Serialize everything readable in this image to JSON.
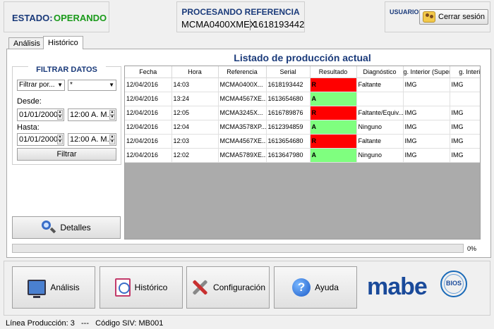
{
  "header": {
    "estado_label": "ESTADO:",
    "estado_value": "OPERANDO",
    "procesando_title": "PROCESANDO REFERENCIA",
    "procesando_model": "MCMA0400XMEX",
    "procesando_serial": "1618193442",
    "usuario_label": "USUARIO",
    "logout_label": "Cerrar sesión"
  },
  "tabs": [
    {
      "label": "Análisis",
      "active": false
    },
    {
      "label": "Histórico",
      "active": true
    }
  ],
  "filter": {
    "title": "FILTRAR DATOS",
    "filter_by": "Filtrar por...",
    "filter_value": "*",
    "desde_label": "Desde:",
    "desde_date": "01/01/2000",
    "desde_time": "12:00 A. M.",
    "hasta_label": "Hasta:",
    "hasta_date": "01/01/2000",
    "hasta_time": "12:00 A. M.",
    "button_label": "Filtrar"
  },
  "detalles_label": "Detalles",
  "table": {
    "title": "Listado de producción actual",
    "columns": [
      "Fecha",
      "Hora",
      "Referencia",
      "Serial",
      "Resultado",
      "Diagnóstico",
      "g. Interior (Superi",
      "g. Interior ("
    ],
    "rows": [
      {
        "fecha": "12/04/2016",
        "hora": "14:03",
        "referencia": "MCMA0400X...",
        "serial": "1618193442",
        "resultado": "R",
        "diagnostico": "Faltante",
        "int_sup": "IMG",
        "int_inf": "IMG"
      },
      {
        "fecha": "12/04/2016",
        "hora": "13:24",
        "referencia": "MCMA4567XE...",
        "serial": "1613654680",
        "resultado": "A",
        "diagnostico": "",
        "int_sup": "",
        "int_inf": ""
      },
      {
        "fecha": "12/04/2016",
        "hora": "12:05",
        "referencia": "MCMA3245X...",
        "serial": "1616789876",
        "resultado": "R",
        "diagnostico": "Faltante/Equiv...",
        "int_sup": "IMG",
        "int_inf": "IMG"
      },
      {
        "fecha": "12/04/2016",
        "hora": "12:04",
        "referencia": "MCMA3578XP...",
        "serial": "1612394859",
        "resultado": "A",
        "diagnostico": "Ninguno",
        "int_sup": "IMG",
        "int_inf": "IMG"
      },
      {
        "fecha": "12/04/2016",
        "hora": "12:03",
        "referencia": "MCMA4567XE...",
        "serial": "1613654680",
        "resultado": "R",
        "diagnostico": "Faltante",
        "int_sup": "IMG",
        "int_inf": "IMG"
      },
      {
        "fecha": "12/04/2016",
        "hora": "12:02",
        "referencia": "MCMA5789XE...",
        "serial": "1613647980",
        "resultado": "A",
        "diagnostico": "Ninguno",
        "int_sup": "IMG",
        "int_inf": "IMG"
      }
    ]
  },
  "progress": {
    "value": 0,
    "label": "0%"
  },
  "nav": {
    "analisis": "Análisis",
    "historico": "Histórico",
    "configuracion": "Configuración",
    "ayuda": "Ayuda"
  },
  "logos": {
    "mabe": "mabe",
    "bios": "BIOS"
  },
  "status_line": "Línea Producción: 3   ---   Código SIV: MB001",
  "colors": {
    "fail": "#ff0000",
    "ok": "#7fff7f",
    "title_blue": "#1a3a7a",
    "status_green": "#1a9a1a"
  }
}
